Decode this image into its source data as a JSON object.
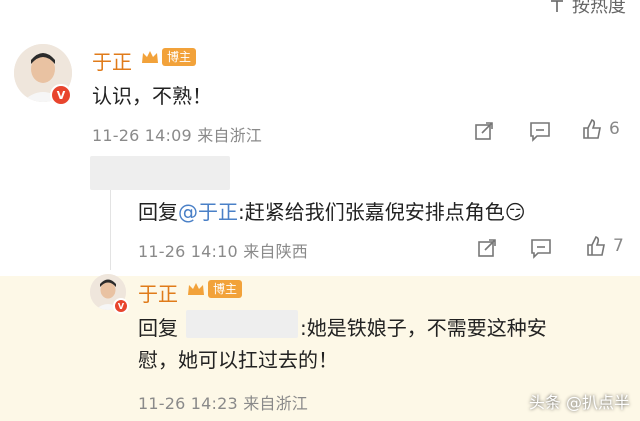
{
  "sort": {
    "label": "按热度"
  },
  "comments": [
    {
      "name": "于正",
      "badge": "博主",
      "text": "认识，不熟！",
      "time": "11-26 14:09",
      "location": "来自浙江",
      "likes": "6"
    },
    {
      "reply_prefix": "回复",
      "reply_mention": "@于正",
      "reply_text": ":赶紧给我们张嘉倪安排点角色",
      "emoji": "😏",
      "time": "11-26 14:10",
      "location": "来自陕西",
      "likes": "7"
    },
    {
      "name": "于正",
      "badge": "博主",
      "reply_prefix": "回复",
      "reply_text_line1": ":她是铁娘子，不需要这种安",
      "reply_text_line2": "慰，她可以扛过去的！",
      "time": "11-26 14:23",
      "location": "来自浙江"
    }
  ],
  "watermark": "头条 @扒点半",
  "colors": {
    "name": "#e07b1a",
    "badge": "#f2a23a",
    "mention": "#4a80c7",
    "highlight_bg": "#fdf8e7"
  }
}
